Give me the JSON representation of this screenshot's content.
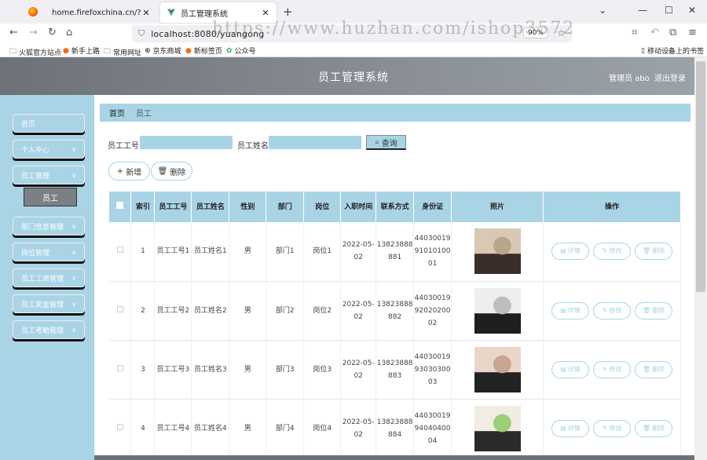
{
  "browser": {
    "tabs": [
      {
        "label": "home.firefoxchina.cn/?from=exte",
        "active": false
      },
      {
        "label": "员工管理系统",
        "active": true
      }
    ],
    "url": "localhost:8080/yuangong",
    "zoom": "90%",
    "watermark": "https://www.huzhan.com/ishop3572",
    "bookmarks": [
      "火狐官方站点",
      "新手上路",
      "常用网址",
      "京东商城",
      "新标签页",
      "公众号"
    ],
    "mobile_bookmarks": "移动设备上的书签"
  },
  "header": {
    "title": "员工管理系统",
    "user": "管理员 abo",
    "logout": "退出登录"
  },
  "sidebar": {
    "items": [
      {
        "label": "首页",
        "chevron": false
      },
      {
        "label": "个人中心",
        "chevron": true
      },
      {
        "label": "员工管理",
        "chevron": true
      },
      {
        "label": "部门信息管理",
        "chevron": true
      },
      {
        "label": "岗位管理",
        "chevron": true
      },
      {
        "label": "员工工资管理",
        "chevron": true
      },
      {
        "label": "员工奖金管理",
        "chevron": true
      },
      {
        "label": "员工考勤管理",
        "chevron": true
      }
    ],
    "submenu_label": "员工"
  },
  "breadcrumb": {
    "home": "首页",
    "current": "员工"
  },
  "search": {
    "id_label": "员工工号",
    "name_label": "员工姓名",
    "query_button": "查询"
  },
  "actions": {
    "add": "新增",
    "delete": "删除"
  },
  "table": {
    "headers": [
      "索引",
      "员工工号",
      "员工姓名",
      "性别",
      "部门",
      "岗位",
      "入职时间",
      "联系方式",
      "身份证",
      "照片",
      "操作"
    ],
    "op_labels": {
      "detail": "详情",
      "edit": "修改",
      "delete": "删除"
    },
    "rows": [
      {
        "index": "1",
        "emp_id": "员工工号1",
        "name": "员工姓名1",
        "gender": "男",
        "dept": "部门1",
        "post": "岗位1",
        "date": "2022-05-02",
        "phone": "13823888881",
        "idcard": "440300199101010001"
      },
      {
        "index": "2",
        "emp_id": "员工工号2",
        "name": "员工姓名2",
        "gender": "男",
        "dept": "部门2",
        "post": "岗位2",
        "date": "2022-05-02",
        "phone": "13823888882",
        "idcard": "440300199202020002"
      },
      {
        "index": "3",
        "emp_id": "员工工号3",
        "name": "员工姓名3",
        "gender": "男",
        "dept": "部门3",
        "post": "岗位3",
        "date": "2022-05-02",
        "phone": "13823888883",
        "idcard": "440300199303030003"
      },
      {
        "index": "4",
        "emp_id": "员工工号4",
        "name": "员工姓名4",
        "gender": "男",
        "dept": "部门4",
        "post": "岗位4",
        "date": "2022-05-02",
        "phone": "13823888884",
        "idcard": "440300199404040004"
      }
    ]
  },
  "colors": {
    "accent": "#a8d4e6",
    "header": "#8a9096",
    "submenu": "#7b8085"
  }
}
